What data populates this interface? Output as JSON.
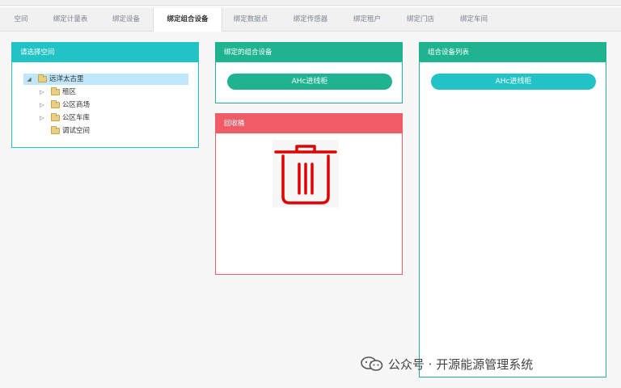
{
  "tabs": [
    {
      "label": "空间",
      "active": false
    },
    {
      "label": "绑定计量表",
      "active": false
    },
    {
      "label": "绑定设备",
      "active": false
    },
    {
      "label": "绑定组合设备",
      "active": true
    },
    {
      "label": "绑定数据点",
      "active": false
    },
    {
      "label": "绑定传感器",
      "active": false
    },
    {
      "label": "绑定租户",
      "active": false
    },
    {
      "label": "绑定门店",
      "active": false
    },
    {
      "label": "绑定车间",
      "active": false
    }
  ],
  "space_panel": {
    "title": "请选择空间",
    "tree": {
      "root": "远洋太古里",
      "children": [
        {
          "label": "租区",
          "expandable": true
        },
        {
          "label": "公区商场",
          "expandable": true
        },
        {
          "label": "公区车库",
          "expandable": true
        },
        {
          "label": "调试空间",
          "expandable": false
        }
      ]
    }
  },
  "bound_panel": {
    "title": "绑定的组合设备",
    "items": [
      "AHc进线柜"
    ]
  },
  "recycle_panel": {
    "title": "回收桶",
    "icon": "trash-icon"
  },
  "list_panel": {
    "title": "组合设备列表",
    "items": [
      "AHc进线柜"
    ]
  },
  "watermark": {
    "text": "公众号 · 开源能源管理系统",
    "icon": "wechat-icon"
  },
  "colors": {
    "cyan": "#22c3c6",
    "green": "#1fb38f",
    "red": "#ef5b67",
    "trash": "#e00000",
    "tree_selected": "#bfe6fb"
  }
}
